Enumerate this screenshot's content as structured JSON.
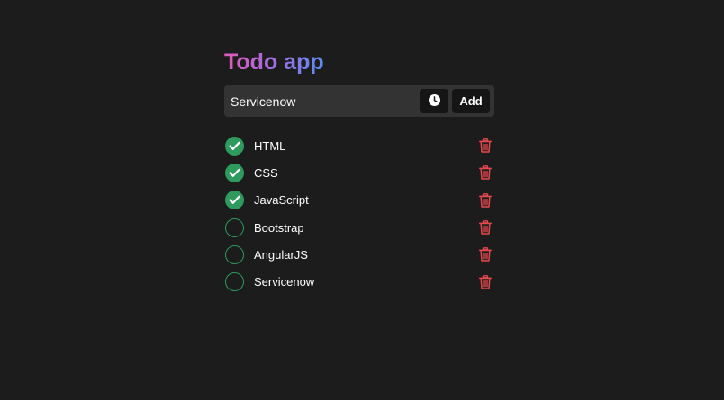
{
  "app": {
    "title": "Todo app"
  },
  "input": {
    "value": "Servicenow",
    "add_label": "Add",
    "clock_icon": "clock-icon"
  },
  "todos": [
    {
      "text": "HTML",
      "done": true
    },
    {
      "text": "CSS",
      "done": true
    },
    {
      "text": "JavaScript",
      "done": true
    },
    {
      "text": "Bootstrap",
      "done": false
    },
    {
      "text": "AngularJS",
      "done": false
    },
    {
      "text": "Servicenow",
      "done": false
    }
  ],
  "colors": {
    "background": "#1c1c1c",
    "input_bar": "#333333",
    "button": "#151515",
    "check_green": "#2f9a5e",
    "delete_red": "#e5484d",
    "title_gradient_start": "#e05ab8",
    "title_gradient_end": "#5a8cf2"
  },
  "icons": {
    "check": "check-icon",
    "delete": "trash-icon"
  }
}
